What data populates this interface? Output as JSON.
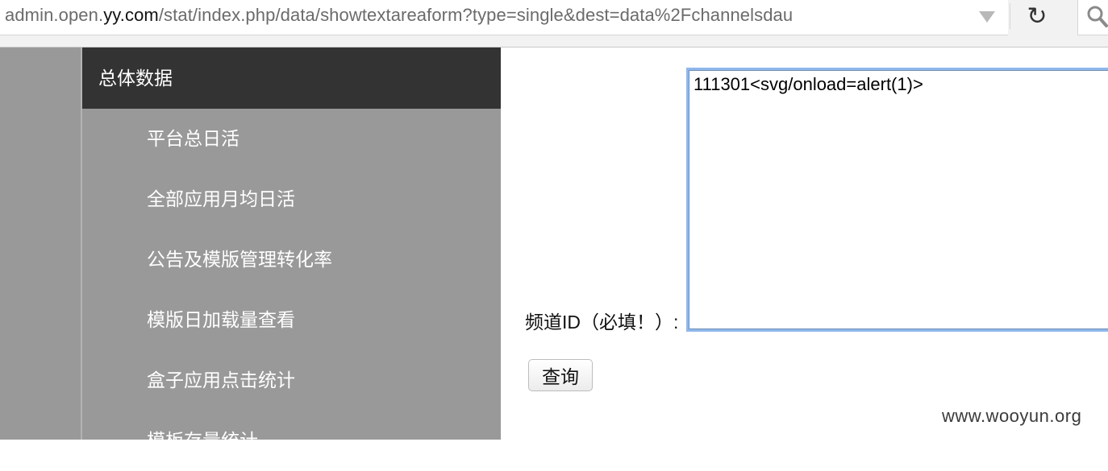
{
  "browser": {
    "url_prefix": "admin.open.",
    "url_host": "yy.com",
    "url_suffix": "/stat/index.php/data/showtextareaform?type=single&dest=data%2Fchannelsdau"
  },
  "sidebar": {
    "header": "总体数据",
    "items": [
      {
        "label": "平台总日活"
      },
      {
        "label": "全部应用月均日活"
      },
      {
        "label": "公告及模版管理转化率"
      },
      {
        "label": "模版日加载量查看"
      },
      {
        "label": "盒子应用点击统计"
      },
      {
        "label": "模板存量统计"
      }
    ]
  },
  "form": {
    "channel_label": "频道ID（必填！）:",
    "channel_value": "111301<svg/onload=alert(1)>",
    "query_button": "查询"
  },
  "watermark": "www.wooyun.org",
  "colors": {
    "sidebar_bg": "#999999",
    "sidebar_header_bg": "#333333",
    "focus_ring": "#8fb8ec"
  }
}
